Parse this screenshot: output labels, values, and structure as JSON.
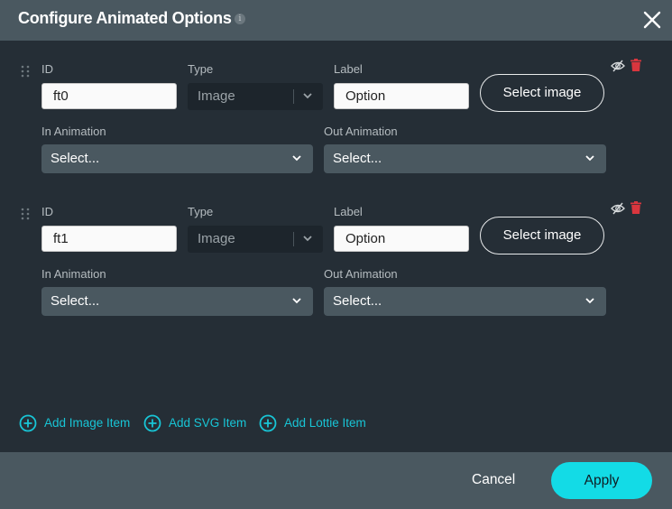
{
  "dialog": {
    "title": "Configure Animated Options",
    "info_icon": "info-icon",
    "close_icon": "close-icon"
  },
  "labels": {
    "id": "ID",
    "type": "Type",
    "label": "Label",
    "in_animation": "In Animation",
    "out_animation": "Out Animation",
    "select_image": "Select image"
  },
  "items": [
    {
      "id": "ft0",
      "type": "Image",
      "label": "Option",
      "in_animation": "Select...",
      "out_animation": "Select..."
    },
    {
      "id": "ft1",
      "type": "Image",
      "label": "Option",
      "in_animation": "Select...",
      "out_animation": "Select..."
    }
  ],
  "add_buttons": [
    {
      "label": "Add Image Item",
      "icon": "plus-circle-icon"
    },
    {
      "label": "Add SVG Item",
      "icon": "plus-circle-icon"
    },
    {
      "label": "Add Lottie Item",
      "icon": "plus-circle-icon"
    }
  ],
  "footer": {
    "cancel_label": "Cancel",
    "apply_label": "Apply"
  },
  "colors": {
    "accent": "#13dbe6",
    "link": "#18c5d6",
    "delete": "#d9363e",
    "header_bg": "#4a5860",
    "body_bg": "#252e36"
  }
}
